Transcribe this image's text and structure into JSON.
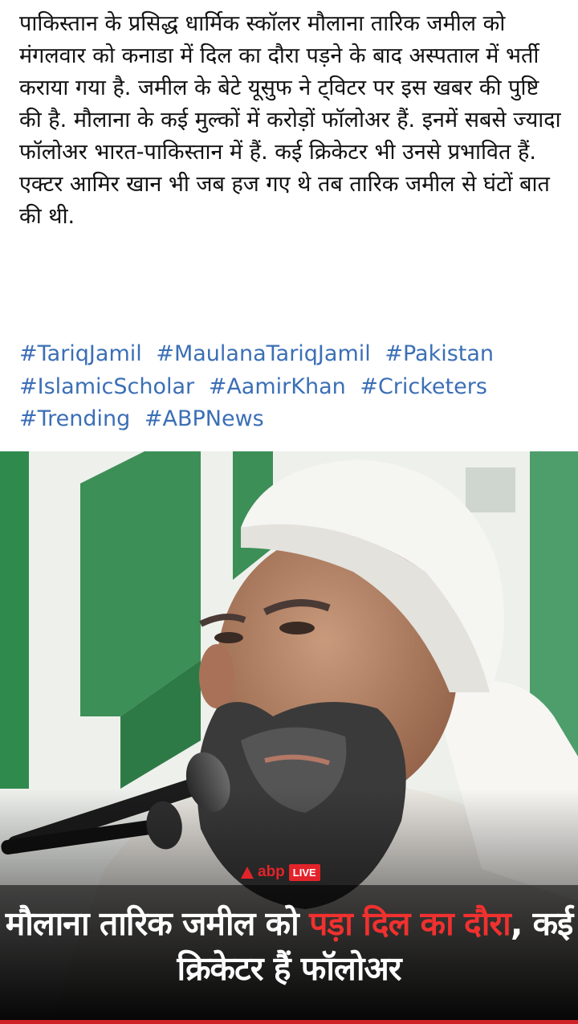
{
  "post": {
    "body": "पाकिस्तान के प्रसिद्ध धार्मिक स्कॉलर मौलाना तारिक जमील को मंगलवार को कनाडा में दिल का दौरा पड़ने के बाद अस्पताल में भर्ती कराया गया है. जमील के बेटे यूसुफ ने ट्विटर पर इस खबर की पुष्टि की है. मौलाना के कई मुल्कों में करोड़ों फॉलोअर हैं. इनमें सबसे ज्यादा फॉलोअर भारत-पाकिस्तान में हैं. कई क्रिकेटर भी उनसे प्रभावित हैं. एक्टर आमिर खान भी जब हज गए थे तब तारिक जमील से घंटों बात की थी.",
    "hashtags": [
      "#TariqJamil",
      "#MaulanaTariqJamil",
      "#Pakistan",
      "#IslamicScholar",
      "#AamirKhan",
      "#Cricketers",
      "#Trending",
      "#ABPNews"
    ]
  },
  "image": {
    "brand": {
      "name": "abp",
      "badge": "LIVE"
    },
    "headline": {
      "part1": "मौलाना तारिक जमील को ",
      "part2_red": "पड़ा दिल का दौरा",
      "part3": ", कई क्रिकेटर हैं फॉलोअर"
    }
  },
  "colors": {
    "hashtag": "#3b6fb6",
    "brand_red": "#e3232a",
    "headline_red": "#f0312f"
  }
}
